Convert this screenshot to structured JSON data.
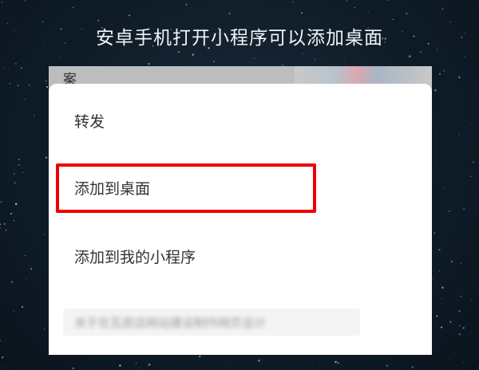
{
  "header": {
    "title": "安卓手机打开小程序可以添加桌面"
  },
  "background_card": {
    "text": "案"
  },
  "menu": {
    "forward_label": "转发",
    "add_to_desktop_label": "添加到桌面",
    "add_to_my_miniprograms_label": "添加到我的小程序",
    "blurred_text": "关于在瓦房店网站建设制作网页设计"
  },
  "colors": {
    "highlight": "#ee0000",
    "sheet": "#ffffff",
    "background": "#0f1c28"
  }
}
